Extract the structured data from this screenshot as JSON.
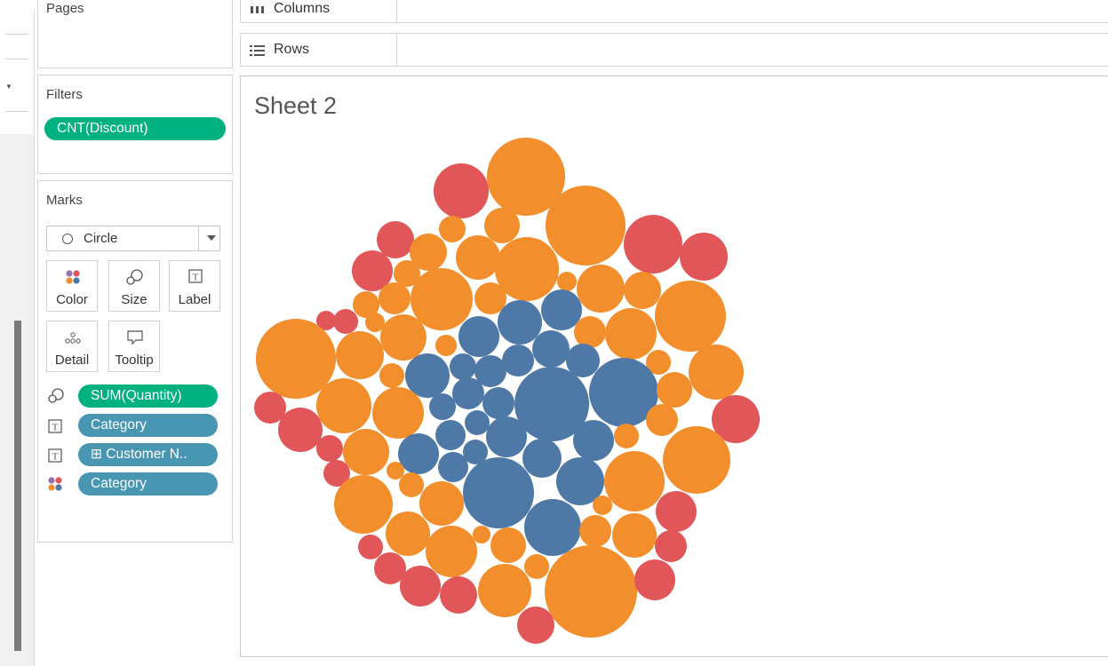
{
  "shelves": {
    "columns_label": "Columns",
    "rows_label": "Rows"
  },
  "pages": {
    "title": "Pages"
  },
  "filters": {
    "title": "Filters",
    "pill": "CNT(Discount)"
  },
  "marks": {
    "title": "Marks",
    "mark_type": "Circle",
    "buttons": {
      "color": "Color",
      "size": "Size",
      "label": "Label",
      "detail": "Detail",
      "tooltip": "Tooltip"
    },
    "fields": {
      "size_field": "SUM(Quantity)",
      "label_field_1": "Category",
      "label_field_2": "⊞ Customer N..",
      "color_field": "Category"
    }
  },
  "sheet": {
    "title": "Sheet 2"
  },
  "colors": {
    "orange": "#f28e2b",
    "blue": "#4e79a7",
    "red": "#e15759",
    "green_pill": "#00b180",
    "teal_pill": "#4996b2"
  },
  "chart_data": {
    "type": "packed-bubble",
    "color_by": "Category",
    "size_by": "SUM(Quantity)",
    "categories": [
      "orange",
      "blue",
      "red"
    ],
    "counts": {
      "orange": 58,
      "blue": 26,
      "red": 22
    }
  }
}
